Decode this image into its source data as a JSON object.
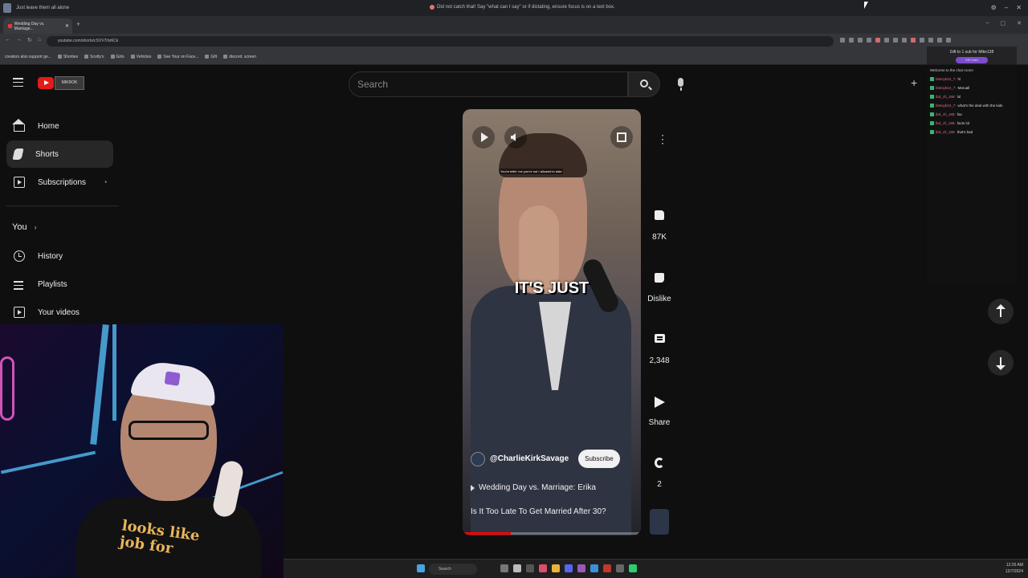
{
  "window": {
    "title_left": "Just leave them all alone",
    "title_center": "Did not catch that! Say \"what can I say\" or if dictating, ensure focus is on a text box."
  },
  "browser": {
    "tab_label": "Wedding Day vs. Marriage...",
    "url": "youtube.com/shorts/cSVV7rbr6Ck",
    "bookmarks": [
      "creators also support ge...",
      "Shorties",
      "Scotty's",
      "Girls",
      "Vehicles",
      "See Your on Face...",
      "Gift",
      "discord. screen"
    ]
  },
  "youtube": {
    "search_placeholder": "Search",
    "logo_tag": "MIKROK",
    "sidebar": {
      "home": "Home",
      "shorts": "Shorts",
      "subscriptions": "Subscriptions",
      "you": "You",
      "history": "History",
      "playlists": "Playlists",
      "your_videos": "Your videos"
    },
    "short": {
      "caption": "IT'S JUST",
      "small_caption": "You're tellin' me you're not / allowed to date",
      "channel": "@CharlieKirkSavage",
      "subscribe": "Subscribe",
      "title_playlist": "Wedding Day vs. Marriage: Erika",
      "title": "Is It Too Late To Get Married After 30?",
      "progress": 0.27
    },
    "actions": {
      "likes": "87K",
      "dislike": "Dislike",
      "comments": "2,348",
      "share": "Share",
      "remix": "2"
    }
  },
  "webcam": {
    "shirt_text": "looks like job for"
  },
  "chat": {
    "header": "Gift to 1 sub for Mike138",
    "gift": "Gift Subs",
    "lines": [
      {
        "user": "Welcome to the chat room!",
        "msg": ""
      },
      {
        "user": "bitesyb24_7:",
        "msg": "hi"
      },
      {
        "user": "bitesyb24_7:",
        "msg": "Maruall"
      },
      {
        "user": "tbd_ch_188:",
        "msg": "lol"
      },
      {
        "user": "bitesyb24_7:",
        "msg": "what's the deal with the kids"
      },
      {
        "user": "tbd_ch_188:",
        "msg": "fax"
      },
      {
        "user": "tbd_ch_188:",
        "msg": "facts lol"
      },
      {
        "user": "tbd_ch_188:",
        "msg": "that's bad"
      }
    ]
  },
  "taskbar": {
    "search": "Search",
    "time": "12:26 AM",
    "date": "12/7/2024"
  }
}
